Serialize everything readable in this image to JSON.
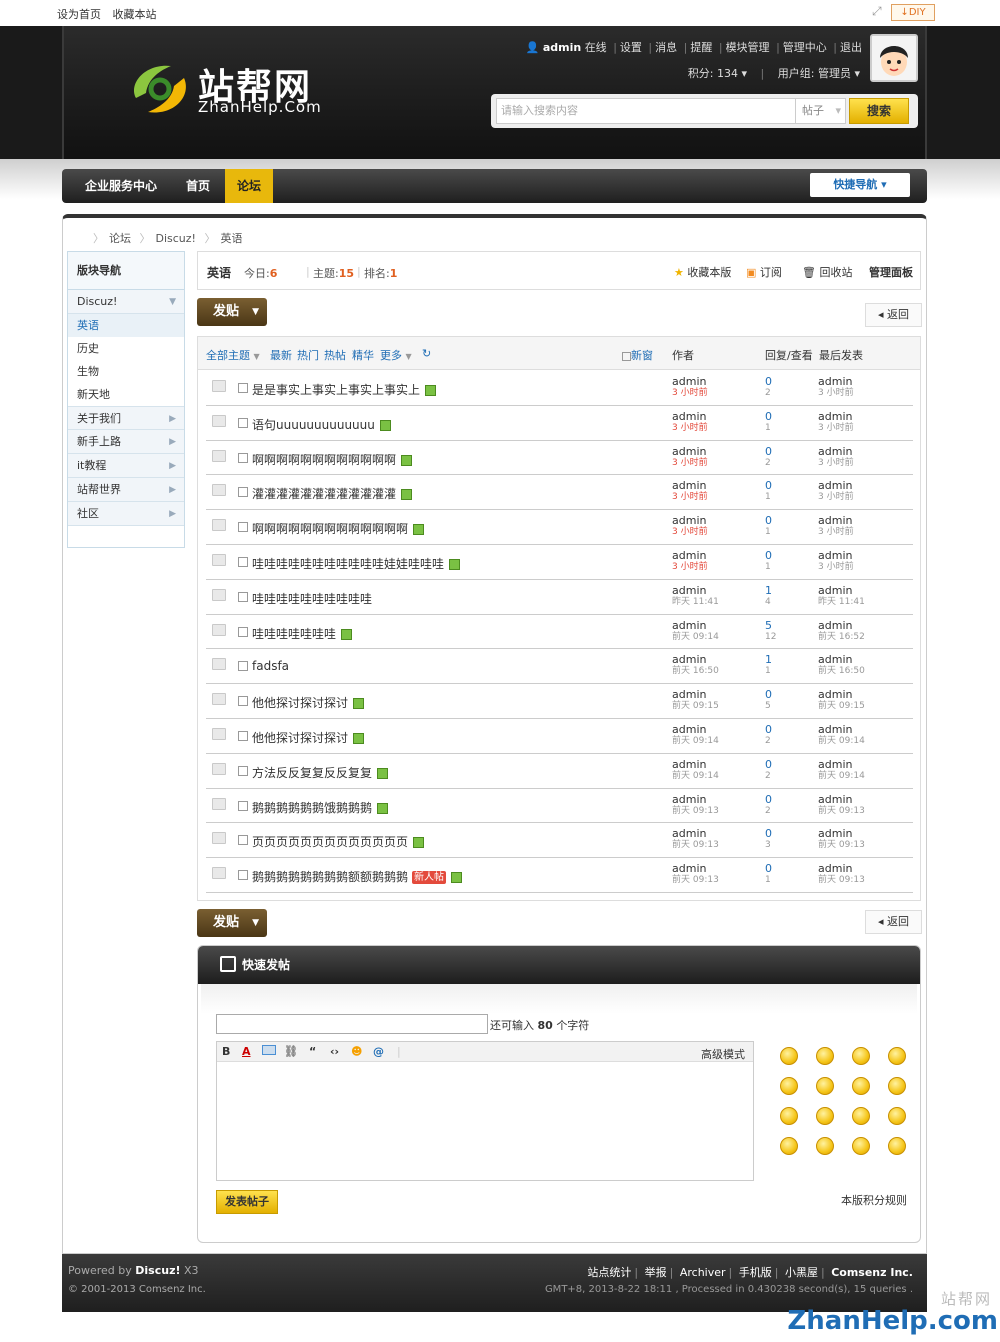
{
  "topbar": {
    "set_home": "设为首页",
    "favorite": "收藏本站",
    "diy": "DIY"
  },
  "logo": {
    "cn": "站帮网",
    "en": "ZhanHelp.Com"
  },
  "usernav": {
    "username": "admin",
    "status": "在线",
    "links": [
      "设置",
      "消息",
      "提醒",
      "模块管理",
      "管理中心",
      "退出"
    ],
    "credits": "积分: 134",
    "group": "用户组: 管理员"
  },
  "search": {
    "placeholder": "请输入搜索内容",
    "type": "帖子",
    "button": "搜索"
  },
  "nav": {
    "items": [
      "企业服务中心",
      "首页",
      "论坛"
    ],
    "quick": "快捷导航"
  },
  "breadcrumb": [
    "论坛",
    "Discuz!",
    "英语"
  ],
  "sidebar": {
    "title": "版块导航",
    "group": "Discuz!",
    "subs": [
      "英语",
      "历史",
      "生物",
      "新天地"
    ],
    "groups": [
      "关于我们",
      "新手上路",
      "it教程",
      "站帮世界",
      "社区"
    ]
  },
  "forum": {
    "name": "英语",
    "today_label": "今日:",
    "today": "6",
    "threads_label": "主题:",
    "threads": "15",
    "rank_label": "排名:",
    "rank": "1",
    "actions": [
      "收藏本版",
      "订阅",
      "回收站",
      "管理面板"
    ]
  },
  "buttons": {
    "post": "发贴",
    "back": "返回"
  },
  "list_header": {
    "filters": [
      "全部主题",
      "最新",
      "热门",
      "热帖",
      "精华",
      "更多"
    ],
    "new_window": "新窗",
    "author": "作者",
    "replies": "回复/查看",
    "last": "最后发表"
  },
  "threads": [
    {
      "title": "是是事实上事实上事实上事实上",
      "author": "admin",
      "time": "3 小时前",
      "replies": "0",
      "views": "2",
      "last_user": "admin",
      "last_time": "3 小时前",
      "attach": true,
      "recent": true
    },
    {
      "title": "语句uuuuuuuuuuuuu",
      "author": "admin",
      "time": "3 小时前",
      "replies": "0",
      "views": "1",
      "last_user": "admin",
      "last_time": "3 小时前",
      "attach": true,
      "recent": true
    },
    {
      "title": "啊啊啊啊啊啊啊啊啊啊啊啊",
      "author": "admin",
      "time": "3 小时前",
      "replies": "0",
      "views": "2",
      "last_user": "admin",
      "last_time": "3 小时前",
      "attach": true,
      "recent": true
    },
    {
      "title": "灌灌灌灌灌灌灌灌灌灌灌灌",
      "author": "admin",
      "time": "3 小时前",
      "replies": "0",
      "views": "1",
      "last_user": "admin",
      "last_time": "3 小时前",
      "attach": true,
      "recent": true
    },
    {
      "title": "啊啊啊啊啊啊啊啊啊啊啊啊啊",
      "author": "admin",
      "time": "3 小时前",
      "replies": "0",
      "views": "1",
      "last_user": "admin",
      "last_time": "3 小时前",
      "attach": true,
      "recent": true
    },
    {
      "title": "哇哇哇哇哇哇哇哇哇哇哇娃娃哇哇哇",
      "author": "admin",
      "time": "3 小时前",
      "replies": "0",
      "views": "1",
      "last_user": "admin",
      "last_time": "3 小时前",
      "attach": true,
      "recent": true
    },
    {
      "title": "哇哇哇哇哇哇哇哇哇哇",
      "author": "admin",
      "time": "昨天 11:41",
      "replies": "1",
      "views": "4",
      "last_user": "admin",
      "last_time": "昨天 11:41",
      "attach": false,
      "recent": false
    },
    {
      "title": "哇哇哇哇哇哇哇",
      "author": "admin",
      "time": "前天 09:14",
      "replies": "5",
      "views": "12",
      "last_user": "admin",
      "last_time": "前天 16:52",
      "attach": true,
      "recent": false
    },
    {
      "title": "fadsfa",
      "author": "admin",
      "time": "前天 16:50",
      "replies": "1",
      "views": "1",
      "last_user": "admin",
      "last_time": "前天 16:50",
      "attach": false,
      "recent": false
    },
    {
      "title": "他他探讨探讨探讨",
      "author": "admin",
      "time": "前天 09:15",
      "replies": "0",
      "views": "5",
      "last_user": "admin",
      "last_time": "前天 09:15",
      "attach": true,
      "recent": false
    },
    {
      "title": "他他探讨探讨探讨",
      "author": "admin",
      "time": "前天 09:14",
      "replies": "0",
      "views": "2",
      "last_user": "admin",
      "last_time": "前天 09:14",
      "attach": true,
      "recent": false
    },
    {
      "title": "方法反反复复反反复复",
      "author": "admin",
      "time": "前天 09:14",
      "replies": "0",
      "views": "2",
      "last_user": "admin",
      "last_time": "前天 09:14",
      "attach": true,
      "recent": false
    },
    {
      "title": "鹅鹅鹅鹅鹅鹅饿鹅鹅鹅",
      "author": "admin",
      "time": "前天 09:13",
      "replies": "0",
      "views": "2",
      "last_user": "admin",
      "last_time": "前天 09:13",
      "attach": true,
      "recent": false
    },
    {
      "title": "页页页页页页页页页页页页页",
      "author": "admin",
      "time": "前天 09:13",
      "replies": "0",
      "views": "3",
      "last_user": "admin",
      "last_time": "前天 09:13",
      "attach": true,
      "recent": false
    },
    {
      "title": "鹅鹅鹅鹅鹅鹅鹅鹅额额鹅鹅鹅",
      "author": "admin",
      "time": "前天 09:13",
      "replies": "0",
      "views": "1",
      "last_user": "admin",
      "last_time": "前天 09:13",
      "attach": true,
      "recent": false,
      "badge": "新人帖"
    }
  ],
  "quickpost": {
    "title": "快速发帖",
    "hint_prefix": "还可输入",
    "hint_count": "80",
    "hint_suffix": "个字符",
    "advanced": "高级模式",
    "submit": "发表帖子",
    "rules": "本版积分规则"
  },
  "footer": {
    "powered": "Powered by",
    "product": "Discuz!",
    "version": "X3",
    "copyright": "© 2001-2013 Comsenz Inc.",
    "links": [
      "站点统计",
      "举报",
      "Archiver",
      "手机版",
      "小黑屋"
    ],
    "company": "Comsenz Inc.",
    "gmt": "GMT+8, 2013-8-22 18:11 , Processed in 0.430238 second(s), 15 queries ."
  },
  "watermark": {
    "cn": "站帮网",
    "en": "ZhanHelp.com"
  }
}
